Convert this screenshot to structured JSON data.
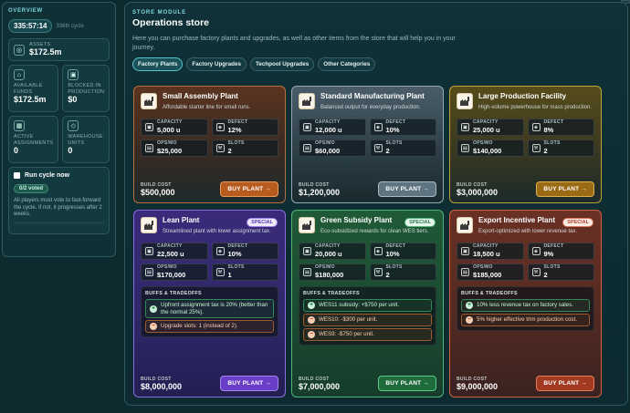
{
  "sidebar": {
    "title": "OVERVIEW",
    "timer": "335:57:14",
    "cycle": "336th cycle",
    "assets": {
      "label": "ASSETS",
      "value": "$172.5m",
      "icon": "coins-icon"
    },
    "stats": [
      {
        "label": "AVAILABLE FUNDS",
        "value": "$172.5m",
        "icon": "bank-icon"
      },
      {
        "label": "BLOCKED IN PRODUCTION",
        "value": "$0",
        "icon": "lock-icon"
      },
      {
        "label": "ACTIVE ASSIGNMENTS",
        "value": "0",
        "icon": "calendar-icon"
      },
      {
        "label": "WAREHOUSE UNITS",
        "value": "0",
        "icon": "box-icon"
      }
    ],
    "run_cycle": {
      "label": "Run cycle now",
      "voted": "0/2 voted",
      "description": "All players must vote to fast-forward the cycle. If not, it progresses after 2 weeks."
    }
  },
  "main": {
    "module": "STORE MODULE",
    "title": "Operations store",
    "intro": "Here you can purchase factory plants and upgrades, as well as other items from the store that will help you in your journey.",
    "tabs": [
      "Factory Plants",
      "Factory Upgrades",
      "Techpool Upgrades",
      "Other Categories"
    ]
  },
  "labels": {
    "capacity": "CAPACITY",
    "defect": "DEFECT",
    "opsmo": "OPS/MO",
    "slots": "SLOTS",
    "build_cost": "BUILD COST",
    "buffs": "BUFFS & TRADEOFFS",
    "buy": "BUY PLANT →"
  },
  "cards": [
    {
      "title": "Small Assembly Plant",
      "subtitle": "Affordable starter line for small runs.",
      "capacity": "5,000 u",
      "defect": "12%",
      "opsmo": "$25,000",
      "slots": "2",
      "cost": "$500,000"
    },
    {
      "title": "Standard Manufacturing Plant",
      "subtitle": "Balanced output for everyday production.",
      "capacity": "12,000 u",
      "defect": "10%",
      "opsmo": "$60,000",
      "slots": "2",
      "cost": "$1,200,000"
    },
    {
      "title": "Large Production Facility",
      "subtitle": "High-volume powerhouse for mass production.",
      "capacity": "25,000 u",
      "defect": "8%",
      "opsmo": "$140,000",
      "slots": "2",
      "cost": "$3,000,000"
    },
    {
      "title": "Lean Plant",
      "subtitle": "Streamlined plant with lower assignment tax.",
      "badge": "SPECIAL",
      "capacity": "22,500 u",
      "defect": "10%",
      "opsmo": "$170,000",
      "slots": "1",
      "cost": "$8,000,000",
      "buffs": [
        {
          "type": "plus",
          "text": "Upfront assignment tax is 20% (better than the normal 25%)."
        },
        {
          "type": "minus",
          "text": "Upgrade slots: 1 (instead of 2)."
        }
      ]
    },
    {
      "title": "Green Subsidy Plant",
      "subtitle": "Eco-subsidized rewards for clean WES tiers.",
      "badge": "SPECIAL",
      "capacity": "20,000 u",
      "defect": "10%",
      "opsmo": "$180,000",
      "slots": "2",
      "cost": "$7,000,000",
      "buffs": [
        {
          "type": "plus",
          "text": "WES11 subsidy: +$750 per unit."
        },
        {
          "type": "minus",
          "text": "WES10: -$300 per unit."
        },
        {
          "type": "minus",
          "text": "WES9: -$750 per unit."
        }
      ]
    },
    {
      "title": "Export Incentive Plant",
      "subtitle": "Export-optimized with lower revenue tax.",
      "badge": "SPECIAL",
      "capacity": "18,500 u",
      "defect": "9%",
      "opsmo": "$185,000",
      "slots": "2",
      "cost": "$9,000,000",
      "buffs": [
        {
          "type": "plus",
          "text": "10% less revenue tax on factory sales."
        },
        {
          "type": "minus",
          "text": "5% higher effective trim production cost."
        }
      ]
    }
  ]
}
